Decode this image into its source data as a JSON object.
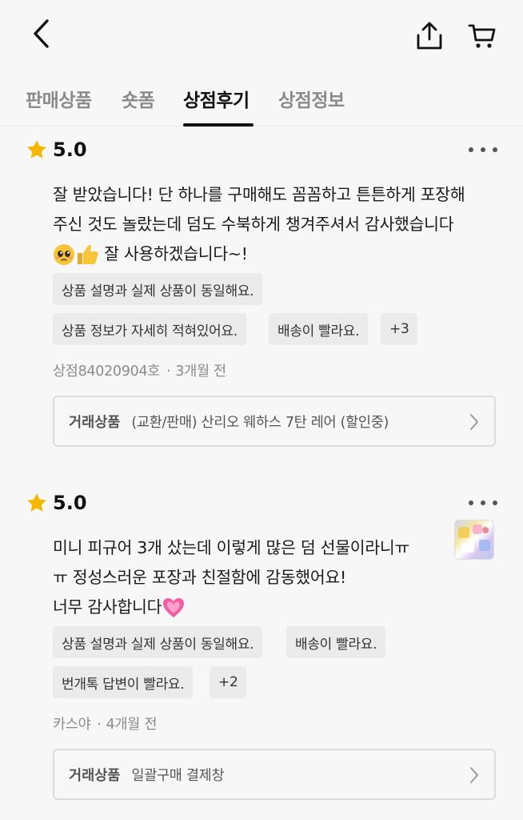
{
  "header": {
    "back_icon": "chevron-left-icon",
    "share_icon": "share-icon",
    "cart_icon": "cart-icon"
  },
  "tabs": [
    {
      "label": "판매상품",
      "active": false
    },
    {
      "label": "숏폼",
      "active": false
    },
    {
      "label": "상점후기",
      "active": true
    },
    {
      "label": "상점정보",
      "active": false
    }
  ],
  "reviews": [
    {
      "rating": "5.0",
      "text_lines": [
        "잘 받았습니다! 단 하나를 구매해도 꼼꼼하고 튼튼하게 포장해",
        "주신 것도 놀랐는데 덤도 수북하게 챙겨주셔서 감사했습니다",
        " 잘 사용하겠습니다~!"
      ],
      "emojis": [
        "pleading-face-emoji",
        "thumbs-up-emoji"
      ],
      "tags": [
        "상품 설명과 실제 상품이 동일해요.",
        "상품 정보가 자세히 적혀있어요.",
        "배송이 빨라요.",
        "+3"
      ],
      "author": "상점84020904호",
      "time": "3개월 전",
      "trade_label": "거래상품",
      "trade_title": "(교환/판매) 산리오 웨하스 7탄 레어 (할인중)"
    },
    {
      "rating": "5.0",
      "text_lines": [
        "미니 피규어 3개 샀는데 이렇게 많은 덤 선물이라니ㅠ",
        "ㅠ 정성스러운 포장과 친절함에 감동했어요!",
        "너무 감사합니다"
      ],
      "emojis": [
        "growing-heart-emoji"
      ],
      "has_photo": true,
      "tags": [
        "상품 설명과 실제 상품이 동일해요.",
        "배송이 빨라요.",
        "번개톡 답변이 빨라요.",
        "+2"
      ],
      "author": "카스야",
      "time": "4개월 전",
      "trade_label": "거래상품",
      "trade_title": "일괄구매 결제창"
    }
  ],
  "colors": {
    "background": "#f7f7f7",
    "star": "#f5b800",
    "tag_bg": "#ebebeb",
    "active_tab": "#111111",
    "inactive_tab": "#8b8b8b"
  }
}
